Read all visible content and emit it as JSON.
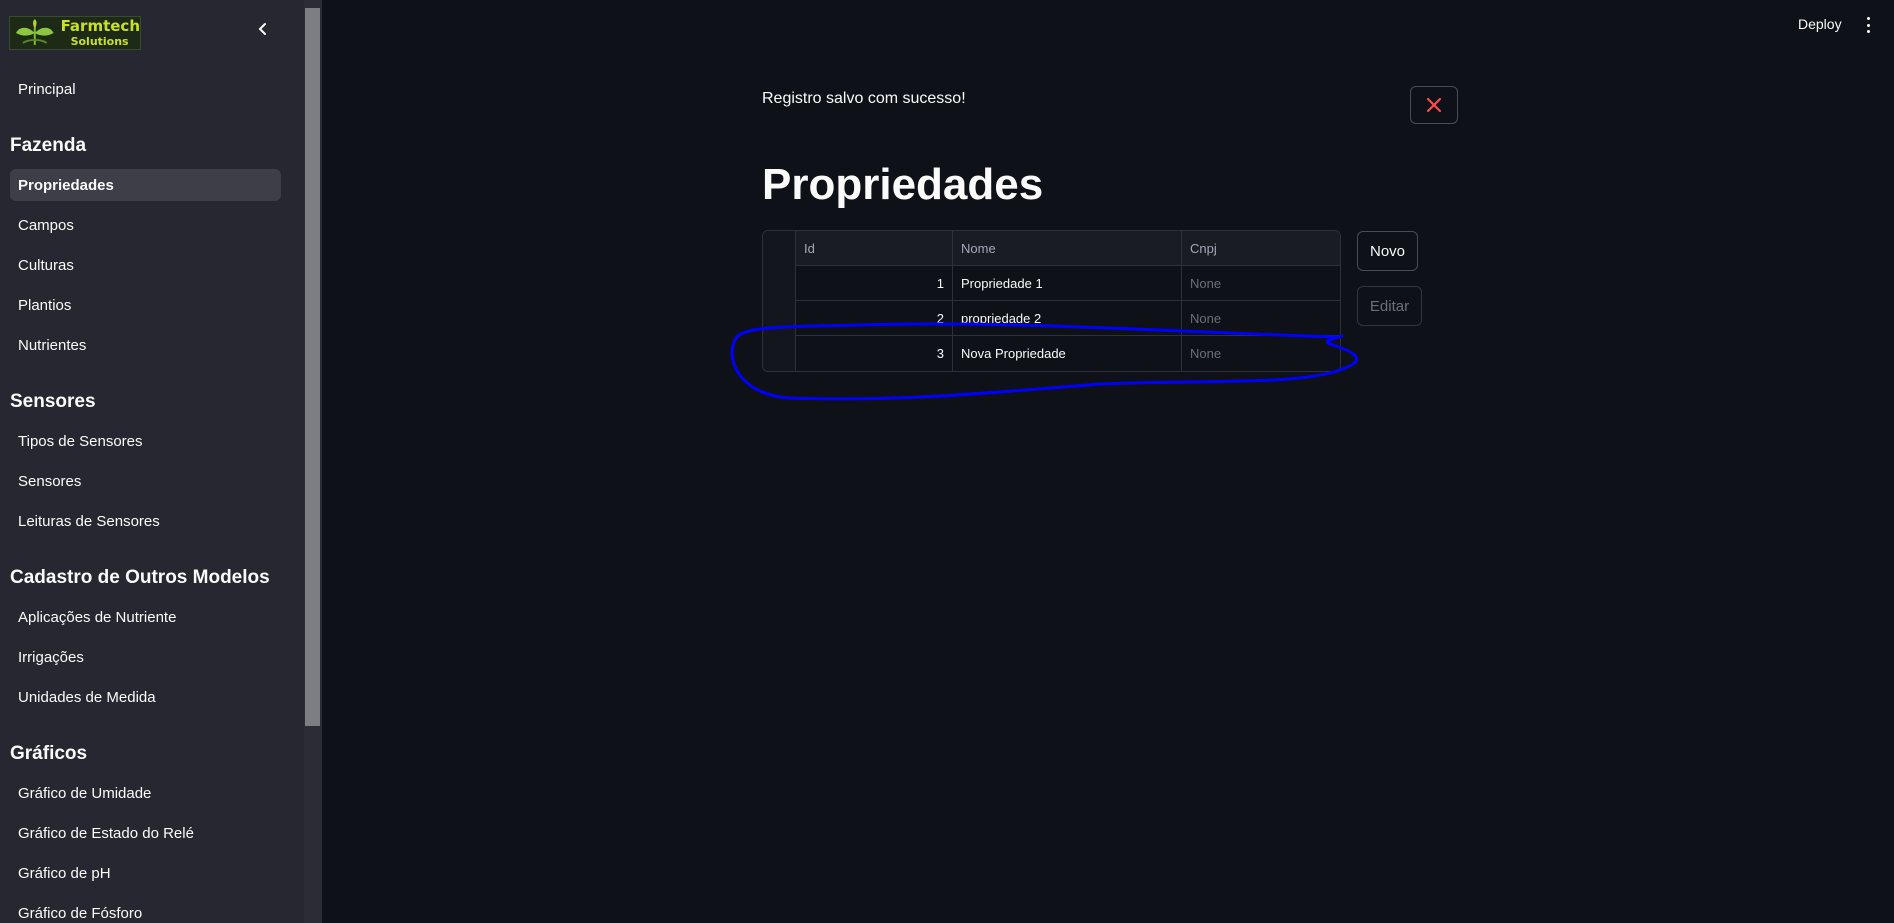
{
  "brand": {
    "title": "Farmtech",
    "subtitle": "Solutions",
    "logo_color": "#c8e02a"
  },
  "sidebar": {
    "top_item": "Principal",
    "sections": [
      {
        "title": "Fazenda",
        "items": [
          "Propriedades",
          "Campos",
          "Culturas",
          "Plantios",
          "Nutrientes"
        ]
      },
      {
        "title": "Sensores",
        "items": [
          "Tipos de Sensores",
          "Sensores",
          "Leituras de Sensores"
        ]
      },
      {
        "title": "Cadastro de Outros Modelos",
        "items": [
          "Aplicações de Nutriente",
          "Irrigações",
          "Unidades de Medida"
        ]
      },
      {
        "title": "Gráficos",
        "items": [
          "Gráfico de Umidade",
          "Gráfico de Estado do Relé",
          "Gráfico de pH",
          "Gráfico de Fósforo"
        ]
      }
    ],
    "active_item": "Propriedades"
  },
  "header": {
    "deploy_label": "Deploy"
  },
  "toast": {
    "message": "Registro salvo com sucesso!"
  },
  "main": {
    "title": "Propriedades",
    "table": {
      "columns": [
        "Id",
        "Nome",
        "Cnpj"
      ],
      "rows": [
        {
          "id": "1",
          "nome": "Propriedade 1",
          "cnpj": "None"
        },
        {
          "id": "2",
          "nome": "propriedade 2",
          "cnpj": "None"
        },
        {
          "id": "3",
          "nome": "Nova Propriedade",
          "cnpj": "None"
        }
      ]
    },
    "buttons": {
      "novo": "Novo",
      "editar": "Editar"
    }
  },
  "colors": {
    "background": "#0e1117",
    "sidebar": "#262730",
    "close_icon": "#ff4b4b",
    "annotation": "#0000ff"
  }
}
